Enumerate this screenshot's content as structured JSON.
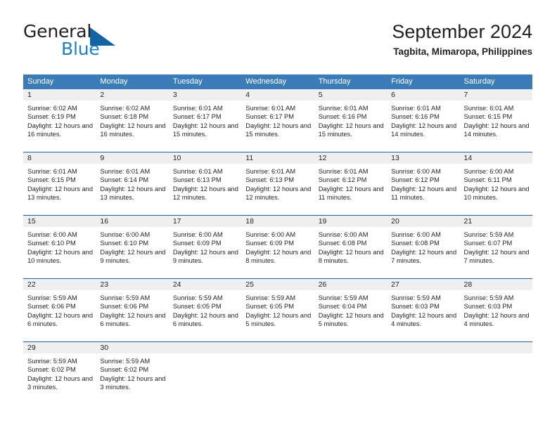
{
  "brand": {
    "name_part1": "General",
    "name_part2": "Blue",
    "mark": "triangle-logo-icon",
    "color_dark": "#231f20",
    "color_blue": "#1f7fc4"
  },
  "header": {
    "title": "September 2024",
    "subtitle": "Tagbita, Mimaropa, Philippines"
  },
  "theme": {
    "header_bg": "#3b7cb8",
    "header_text": "#ffffff",
    "row_divider": "#1f5f9e",
    "day_band_bg": "#efefef",
    "body_text": "#231f20"
  },
  "weekdays": [
    "Sunday",
    "Monday",
    "Tuesday",
    "Wednesday",
    "Thursday",
    "Friday",
    "Saturday"
  ],
  "weeks": [
    [
      {
        "day": "1",
        "sunrise": "Sunrise: 6:02 AM",
        "sunset": "Sunset: 6:19 PM",
        "daylight": "Daylight: 12 hours and 16 minutes."
      },
      {
        "day": "2",
        "sunrise": "Sunrise: 6:02 AM",
        "sunset": "Sunset: 6:18 PM",
        "daylight": "Daylight: 12 hours and 16 minutes."
      },
      {
        "day": "3",
        "sunrise": "Sunrise: 6:01 AM",
        "sunset": "Sunset: 6:17 PM",
        "daylight": "Daylight: 12 hours and 15 minutes."
      },
      {
        "day": "4",
        "sunrise": "Sunrise: 6:01 AM",
        "sunset": "Sunset: 6:17 PM",
        "daylight": "Daylight: 12 hours and 15 minutes."
      },
      {
        "day": "5",
        "sunrise": "Sunrise: 6:01 AM",
        "sunset": "Sunset: 6:16 PM",
        "daylight": "Daylight: 12 hours and 15 minutes."
      },
      {
        "day": "6",
        "sunrise": "Sunrise: 6:01 AM",
        "sunset": "Sunset: 6:16 PM",
        "daylight": "Daylight: 12 hours and 14 minutes."
      },
      {
        "day": "7",
        "sunrise": "Sunrise: 6:01 AM",
        "sunset": "Sunset: 6:15 PM",
        "daylight": "Daylight: 12 hours and 14 minutes."
      }
    ],
    [
      {
        "day": "8",
        "sunrise": "Sunrise: 6:01 AM",
        "sunset": "Sunset: 6:15 PM",
        "daylight": "Daylight: 12 hours and 13 minutes."
      },
      {
        "day": "9",
        "sunrise": "Sunrise: 6:01 AM",
        "sunset": "Sunset: 6:14 PM",
        "daylight": "Daylight: 12 hours and 13 minutes."
      },
      {
        "day": "10",
        "sunrise": "Sunrise: 6:01 AM",
        "sunset": "Sunset: 6:13 PM",
        "daylight": "Daylight: 12 hours and 12 minutes."
      },
      {
        "day": "11",
        "sunrise": "Sunrise: 6:01 AM",
        "sunset": "Sunset: 6:13 PM",
        "daylight": "Daylight: 12 hours and 12 minutes."
      },
      {
        "day": "12",
        "sunrise": "Sunrise: 6:01 AM",
        "sunset": "Sunset: 6:12 PM",
        "daylight": "Daylight: 12 hours and 11 minutes."
      },
      {
        "day": "13",
        "sunrise": "Sunrise: 6:00 AM",
        "sunset": "Sunset: 6:12 PM",
        "daylight": "Daylight: 12 hours and 11 minutes."
      },
      {
        "day": "14",
        "sunrise": "Sunrise: 6:00 AM",
        "sunset": "Sunset: 6:11 PM",
        "daylight": "Daylight: 12 hours and 10 minutes."
      }
    ],
    [
      {
        "day": "15",
        "sunrise": "Sunrise: 6:00 AM",
        "sunset": "Sunset: 6:10 PM",
        "daylight": "Daylight: 12 hours and 10 minutes."
      },
      {
        "day": "16",
        "sunrise": "Sunrise: 6:00 AM",
        "sunset": "Sunset: 6:10 PM",
        "daylight": "Daylight: 12 hours and 9 minutes."
      },
      {
        "day": "17",
        "sunrise": "Sunrise: 6:00 AM",
        "sunset": "Sunset: 6:09 PM",
        "daylight": "Daylight: 12 hours and 9 minutes."
      },
      {
        "day": "18",
        "sunrise": "Sunrise: 6:00 AM",
        "sunset": "Sunset: 6:09 PM",
        "daylight": "Daylight: 12 hours and 8 minutes."
      },
      {
        "day": "19",
        "sunrise": "Sunrise: 6:00 AM",
        "sunset": "Sunset: 6:08 PM",
        "daylight": "Daylight: 12 hours and 8 minutes."
      },
      {
        "day": "20",
        "sunrise": "Sunrise: 6:00 AM",
        "sunset": "Sunset: 6:08 PM",
        "daylight": "Daylight: 12 hours and 7 minutes."
      },
      {
        "day": "21",
        "sunrise": "Sunrise: 5:59 AM",
        "sunset": "Sunset: 6:07 PM",
        "daylight": "Daylight: 12 hours and 7 minutes."
      }
    ],
    [
      {
        "day": "22",
        "sunrise": "Sunrise: 5:59 AM",
        "sunset": "Sunset: 6:06 PM",
        "daylight": "Daylight: 12 hours and 6 minutes."
      },
      {
        "day": "23",
        "sunrise": "Sunrise: 5:59 AM",
        "sunset": "Sunset: 6:06 PM",
        "daylight": "Daylight: 12 hours and 6 minutes."
      },
      {
        "day": "24",
        "sunrise": "Sunrise: 5:59 AM",
        "sunset": "Sunset: 6:05 PM",
        "daylight": "Daylight: 12 hours and 6 minutes."
      },
      {
        "day": "25",
        "sunrise": "Sunrise: 5:59 AM",
        "sunset": "Sunset: 6:05 PM",
        "daylight": "Daylight: 12 hours and 5 minutes."
      },
      {
        "day": "26",
        "sunrise": "Sunrise: 5:59 AM",
        "sunset": "Sunset: 6:04 PM",
        "daylight": "Daylight: 12 hours and 5 minutes."
      },
      {
        "day": "27",
        "sunrise": "Sunrise: 5:59 AM",
        "sunset": "Sunset: 6:03 PM",
        "daylight": "Daylight: 12 hours and 4 minutes."
      },
      {
        "day": "28",
        "sunrise": "Sunrise: 5:59 AM",
        "sunset": "Sunset: 6:03 PM",
        "daylight": "Daylight: 12 hours and 4 minutes."
      }
    ],
    [
      {
        "day": "29",
        "sunrise": "Sunrise: 5:59 AM",
        "sunset": "Sunset: 6:02 PM",
        "daylight": "Daylight: 12 hours and 3 minutes."
      },
      {
        "day": "30",
        "sunrise": "Sunrise: 5:59 AM",
        "sunset": "Sunset: 6:02 PM",
        "daylight": "Daylight: 12 hours and 3 minutes."
      },
      {
        "day": "",
        "sunrise": "",
        "sunset": "",
        "daylight": ""
      },
      {
        "day": "",
        "sunrise": "",
        "sunset": "",
        "daylight": ""
      },
      {
        "day": "",
        "sunrise": "",
        "sunset": "",
        "daylight": ""
      },
      {
        "day": "",
        "sunrise": "",
        "sunset": "",
        "daylight": ""
      },
      {
        "day": "",
        "sunrise": "",
        "sunset": "",
        "daylight": ""
      }
    ]
  ]
}
